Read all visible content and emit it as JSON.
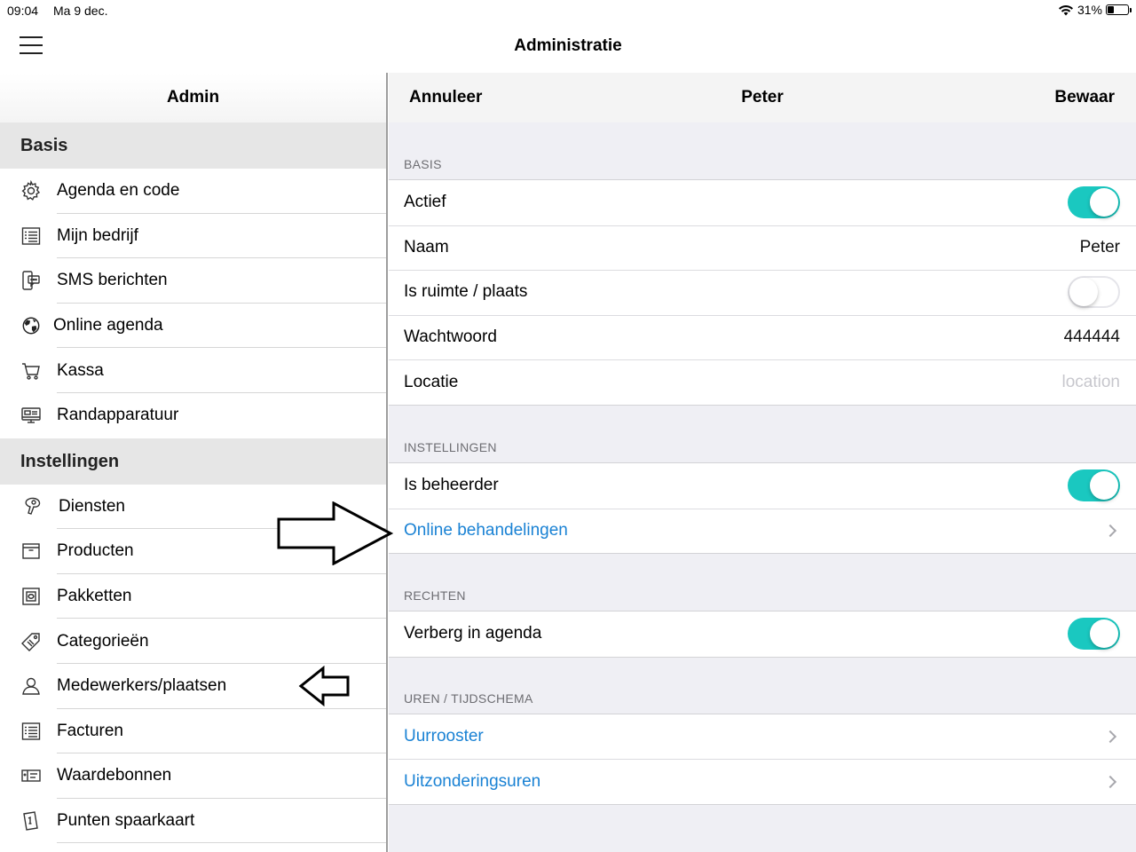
{
  "status_bar": {
    "time": "09:04",
    "date": "Ma 9 dec.",
    "battery_percent": "31%",
    "battery_level": 0.31
  },
  "app": {
    "title": "Administratie",
    "menu_icon": "hamburger-icon"
  },
  "left": {
    "header": "Admin",
    "sections": [
      {
        "title": "Basis",
        "items": [
          {
            "label": "Agenda en code",
            "icon": "gear-icon"
          },
          {
            "label": "Mijn bedrijf",
            "icon": "list-icon"
          },
          {
            "label": "SMS berichten",
            "icon": "sms-phone-icon"
          },
          {
            "label": "Online agenda",
            "icon": "globe-icon"
          },
          {
            "label": "Kassa",
            "icon": "cart-icon"
          },
          {
            "label": "Randapparatuur",
            "icon": "devices-icon"
          }
        ]
      },
      {
        "title": "Instellingen",
        "items": [
          {
            "label": "Diensten",
            "icon": "hairdryer-icon"
          },
          {
            "label": "Producten",
            "icon": "box-icon"
          },
          {
            "label": "Pakketten",
            "icon": "package-icon"
          },
          {
            "label": "Categorieën",
            "icon": "tags-icon"
          },
          {
            "label": "Medewerkers/plaatsen",
            "icon": "person-icon"
          },
          {
            "label": "Facturen",
            "icon": "invoice-icon"
          },
          {
            "label": "Waardebonnen",
            "icon": "voucher-icon"
          },
          {
            "label": "Punten spaarkaart",
            "icon": "loyalty-card-icon"
          }
        ]
      }
    ]
  },
  "right": {
    "nav": {
      "cancel": "Annuleer",
      "title": "Peter",
      "save": "Bewaar"
    },
    "groups": {
      "basis": {
        "label": "BASIS",
        "actief": {
          "label": "Actief",
          "on": true
        },
        "naam": {
          "label": "Naam",
          "value": "Peter"
        },
        "ruimte": {
          "label": "Is ruimte / plaats",
          "on": false
        },
        "wachtwoord": {
          "label": "Wachtwoord",
          "value": "444444"
        },
        "locatie": {
          "label": "Locatie",
          "placeholder": "location"
        }
      },
      "instellingen": {
        "label": "INSTELLINGEN",
        "beheerder": {
          "label": "Is beheerder",
          "on": true
        },
        "online": {
          "label": "Online behandelingen"
        }
      },
      "rechten": {
        "label": "RECHTEN",
        "verberg": {
          "label": "Verberg in agenda",
          "on": true
        }
      },
      "uren": {
        "label": "UREN / TIJDSCHEMA",
        "uurrooster": {
          "label": "Uurrooster"
        },
        "uitzondering": {
          "label": "Uitzonderingsuren"
        }
      }
    }
  },
  "colors": {
    "toggle_on": "#1ac8c0",
    "link": "#1a82d4",
    "section_bg": "#e6e6e6",
    "right_bg": "#efeff4"
  }
}
